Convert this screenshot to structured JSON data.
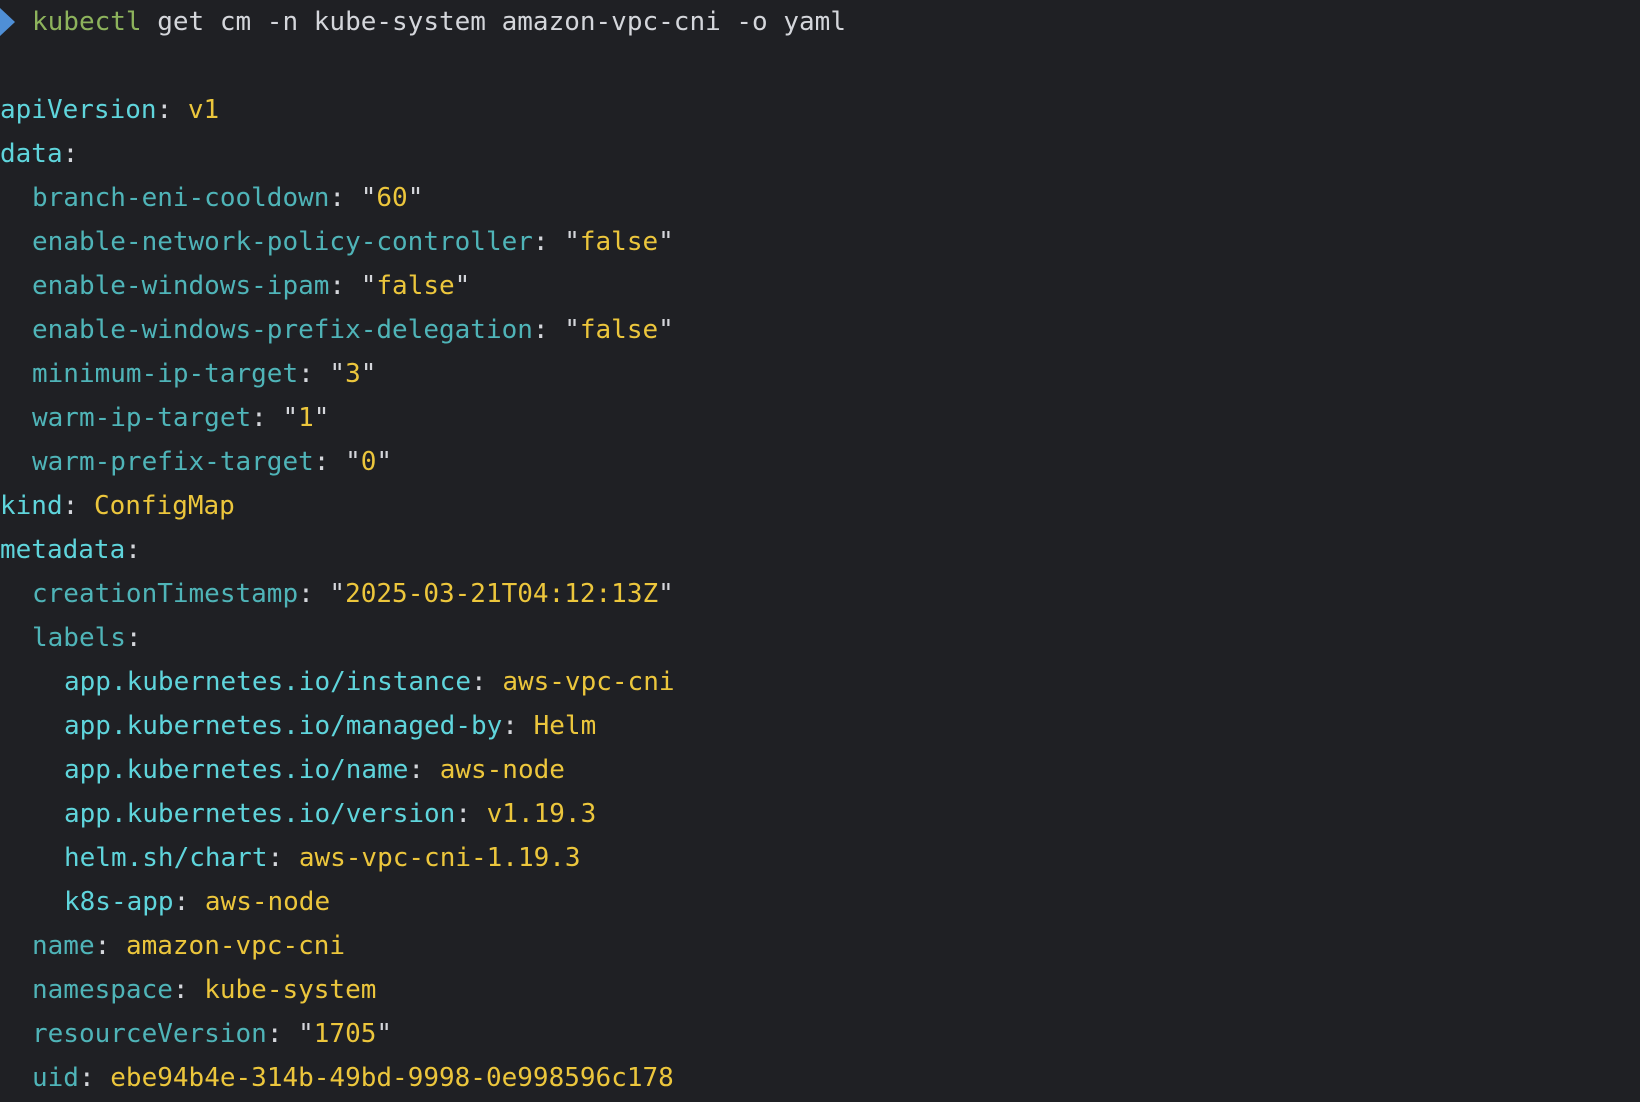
{
  "prompt": {
    "command": "kubectl",
    "args": " get cm -n kube-system amazon-vpc-cni -o yaml"
  },
  "output": [
    {
      "indent": 0,
      "key": "apiVersion",
      "value": "v1"
    },
    {
      "indent": 0,
      "key": "data",
      "value": ""
    },
    {
      "indent": 1,
      "key": "branch-eni-cooldown",
      "value": "\"60\""
    },
    {
      "indent": 1,
      "key": "enable-network-policy-controller",
      "value": "\"false\""
    },
    {
      "indent": 1,
      "key": "enable-windows-ipam",
      "value": "\"false\""
    },
    {
      "indent": 1,
      "key": "enable-windows-prefix-delegation",
      "value": "\"false\""
    },
    {
      "indent": 1,
      "key": "minimum-ip-target",
      "value": "\"3\""
    },
    {
      "indent": 1,
      "key": "warm-ip-target",
      "value": "\"1\""
    },
    {
      "indent": 1,
      "key": "warm-prefix-target",
      "value": "\"0\""
    },
    {
      "indent": 0,
      "key": "kind",
      "value": "ConfigMap"
    },
    {
      "indent": 0,
      "key": "metadata",
      "value": ""
    },
    {
      "indent": 1,
      "key": "creationTimestamp",
      "value": "\"2025-03-21T04:12:13Z\""
    },
    {
      "indent": 1,
      "key": "labels",
      "value": ""
    },
    {
      "indent": 2,
      "key": "app.kubernetes.io/instance",
      "value": "aws-vpc-cni"
    },
    {
      "indent": 2,
      "key": "app.kubernetes.io/managed-by",
      "value": "Helm"
    },
    {
      "indent": 2,
      "key": "app.kubernetes.io/name",
      "value": "aws-node"
    },
    {
      "indent": 2,
      "key": "app.kubernetes.io/version",
      "value": "v1.19.3"
    },
    {
      "indent": 2,
      "key": "helm.sh/chart",
      "value": "aws-vpc-cni-1.19.3"
    },
    {
      "indent": 2,
      "key": "k8s-app",
      "value": "aws-node"
    },
    {
      "indent": 1,
      "key": "name",
      "value": "amazon-vpc-cni"
    },
    {
      "indent": 1,
      "key": "namespace",
      "value": "kube-system"
    },
    {
      "indent": 1,
      "key": "resourceVersion",
      "value": "\"1705\""
    },
    {
      "indent": 1,
      "key": "uid",
      "value": "ebe94b4e-314b-49bd-9998-0e998596c178"
    }
  ],
  "colors": {
    "background": "#1f2024",
    "prompt_arrow": "#4f8fd6",
    "command": "#8db35c",
    "key_top": "#5fd5dc",
    "key_nested": "#4fb4b8",
    "value": "#ecc63c",
    "punctuation": "#d4d6db"
  }
}
